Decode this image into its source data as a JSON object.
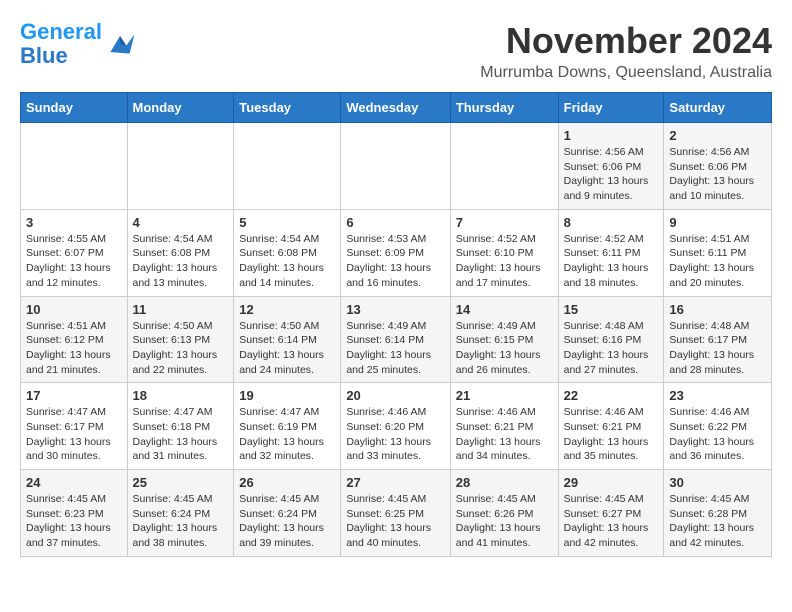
{
  "logo": {
    "line1": "General",
    "line2": "Blue"
  },
  "title": "November 2024",
  "subtitle": "Murrumba Downs, Queensland, Australia",
  "days_of_week": [
    "Sunday",
    "Monday",
    "Tuesday",
    "Wednesday",
    "Thursday",
    "Friday",
    "Saturday"
  ],
  "weeks": [
    [
      {
        "day": "",
        "info": ""
      },
      {
        "day": "",
        "info": ""
      },
      {
        "day": "",
        "info": ""
      },
      {
        "day": "",
        "info": ""
      },
      {
        "day": "",
        "info": ""
      },
      {
        "day": "1",
        "info": "Sunrise: 4:56 AM\nSunset: 6:06 PM\nDaylight: 13 hours and 9 minutes."
      },
      {
        "day": "2",
        "info": "Sunrise: 4:56 AM\nSunset: 6:06 PM\nDaylight: 13 hours and 10 minutes."
      }
    ],
    [
      {
        "day": "3",
        "info": "Sunrise: 4:55 AM\nSunset: 6:07 PM\nDaylight: 13 hours and 12 minutes."
      },
      {
        "day": "4",
        "info": "Sunrise: 4:54 AM\nSunset: 6:08 PM\nDaylight: 13 hours and 13 minutes."
      },
      {
        "day": "5",
        "info": "Sunrise: 4:54 AM\nSunset: 6:08 PM\nDaylight: 13 hours and 14 minutes."
      },
      {
        "day": "6",
        "info": "Sunrise: 4:53 AM\nSunset: 6:09 PM\nDaylight: 13 hours and 16 minutes."
      },
      {
        "day": "7",
        "info": "Sunrise: 4:52 AM\nSunset: 6:10 PM\nDaylight: 13 hours and 17 minutes."
      },
      {
        "day": "8",
        "info": "Sunrise: 4:52 AM\nSunset: 6:11 PM\nDaylight: 13 hours and 18 minutes."
      },
      {
        "day": "9",
        "info": "Sunrise: 4:51 AM\nSunset: 6:11 PM\nDaylight: 13 hours and 20 minutes."
      }
    ],
    [
      {
        "day": "10",
        "info": "Sunrise: 4:51 AM\nSunset: 6:12 PM\nDaylight: 13 hours and 21 minutes."
      },
      {
        "day": "11",
        "info": "Sunrise: 4:50 AM\nSunset: 6:13 PM\nDaylight: 13 hours and 22 minutes."
      },
      {
        "day": "12",
        "info": "Sunrise: 4:50 AM\nSunset: 6:14 PM\nDaylight: 13 hours and 24 minutes."
      },
      {
        "day": "13",
        "info": "Sunrise: 4:49 AM\nSunset: 6:14 PM\nDaylight: 13 hours and 25 minutes."
      },
      {
        "day": "14",
        "info": "Sunrise: 4:49 AM\nSunset: 6:15 PM\nDaylight: 13 hours and 26 minutes."
      },
      {
        "day": "15",
        "info": "Sunrise: 4:48 AM\nSunset: 6:16 PM\nDaylight: 13 hours and 27 minutes."
      },
      {
        "day": "16",
        "info": "Sunrise: 4:48 AM\nSunset: 6:17 PM\nDaylight: 13 hours and 28 minutes."
      }
    ],
    [
      {
        "day": "17",
        "info": "Sunrise: 4:47 AM\nSunset: 6:17 PM\nDaylight: 13 hours and 30 minutes."
      },
      {
        "day": "18",
        "info": "Sunrise: 4:47 AM\nSunset: 6:18 PM\nDaylight: 13 hours and 31 minutes."
      },
      {
        "day": "19",
        "info": "Sunrise: 4:47 AM\nSunset: 6:19 PM\nDaylight: 13 hours and 32 minutes."
      },
      {
        "day": "20",
        "info": "Sunrise: 4:46 AM\nSunset: 6:20 PM\nDaylight: 13 hours and 33 minutes."
      },
      {
        "day": "21",
        "info": "Sunrise: 4:46 AM\nSunset: 6:21 PM\nDaylight: 13 hours and 34 minutes."
      },
      {
        "day": "22",
        "info": "Sunrise: 4:46 AM\nSunset: 6:21 PM\nDaylight: 13 hours and 35 minutes."
      },
      {
        "day": "23",
        "info": "Sunrise: 4:46 AM\nSunset: 6:22 PM\nDaylight: 13 hours and 36 minutes."
      }
    ],
    [
      {
        "day": "24",
        "info": "Sunrise: 4:45 AM\nSunset: 6:23 PM\nDaylight: 13 hours and 37 minutes."
      },
      {
        "day": "25",
        "info": "Sunrise: 4:45 AM\nSunset: 6:24 PM\nDaylight: 13 hours and 38 minutes."
      },
      {
        "day": "26",
        "info": "Sunrise: 4:45 AM\nSunset: 6:24 PM\nDaylight: 13 hours and 39 minutes."
      },
      {
        "day": "27",
        "info": "Sunrise: 4:45 AM\nSunset: 6:25 PM\nDaylight: 13 hours and 40 minutes."
      },
      {
        "day": "28",
        "info": "Sunrise: 4:45 AM\nSunset: 6:26 PM\nDaylight: 13 hours and 41 minutes."
      },
      {
        "day": "29",
        "info": "Sunrise: 4:45 AM\nSunset: 6:27 PM\nDaylight: 13 hours and 42 minutes."
      },
      {
        "day": "30",
        "info": "Sunrise: 4:45 AM\nSunset: 6:28 PM\nDaylight: 13 hours and 42 minutes."
      }
    ]
  ]
}
